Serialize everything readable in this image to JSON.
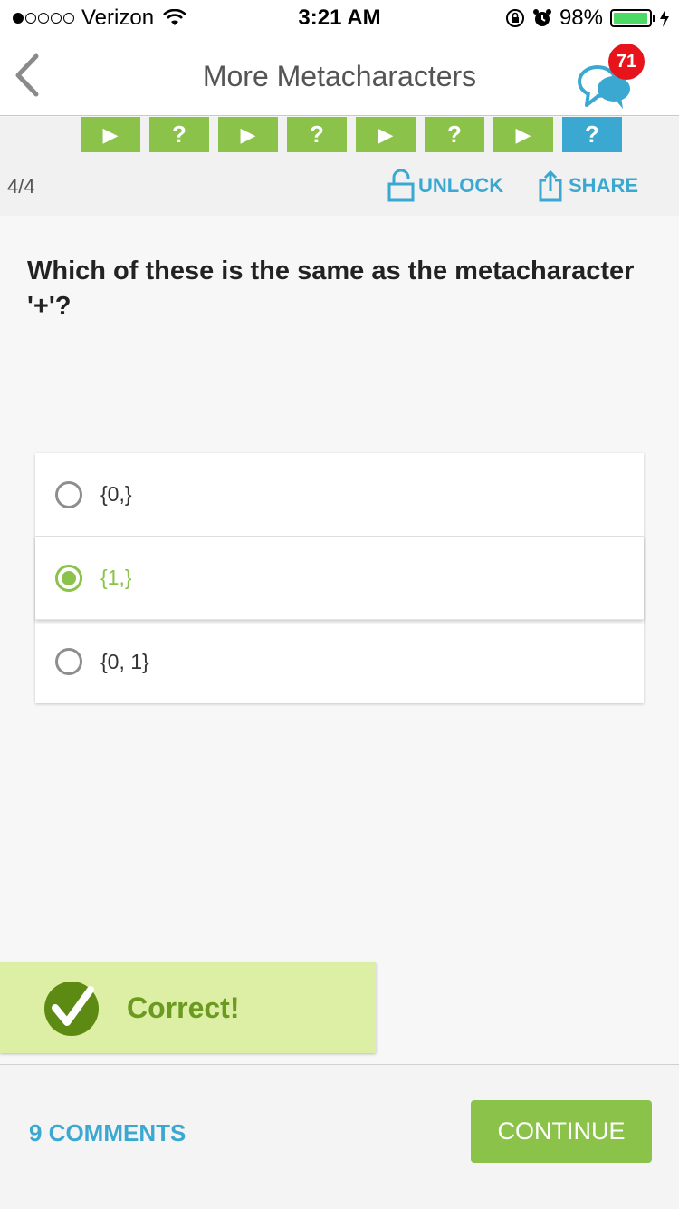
{
  "status_bar": {
    "carrier": "Verizon",
    "time": "3:21 AM",
    "battery_percent": "98%",
    "battery_level": 0.98
  },
  "nav": {
    "title": "More Metacharacters",
    "chat_badge": "71"
  },
  "lesson": {
    "steps": [
      {
        "type": "play",
        "symbol": "▶",
        "state": "complete"
      },
      {
        "type": "quiz",
        "symbol": "?",
        "state": "complete"
      },
      {
        "type": "play",
        "symbol": "▶",
        "state": "complete"
      },
      {
        "type": "quiz",
        "symbol": "?",
        "state": "complete"
      },
      {
        "type": "play",
        "symbol": "▶",
        "state": "complete"
      },
      {
        "type": "quiz",
        "symbol": "?",
        "state": "complete"
      },
      {
        "type": "play",
        "symbol": "▶",
        "state": "complete"
      },
      {
        "type": "quiz",
        "symbol": "?",
        "state": "active"
      }
    ],
    "progress": "4/4",
    "unlock_label": "UNLOCK",
    "share_label": "SHARE"
  },
  "question": {
    "text": "Which of these is the same as the metacharacter '+'?",
    "options": [
      {
        "label": "{0,}",
        "selected": false
      },
      {
        "label": "{1,}",
        "selected": true
      },
      {
        "label": "{0, 1}",
        "selected": false
      }
    ]
  },
  "result": {
    "text": "Correct!"
  },
  "footer": {
    "comments_label": "9 COMMENTS",
    "continue_label": "CONTINUE"
  },
  "colors": {
    "green": "#8bc34a",
    "blue": "#3aa8d1",
    "badge_red": "#e8141b",
    "result_bg": "#ddeea5"
  }
}
